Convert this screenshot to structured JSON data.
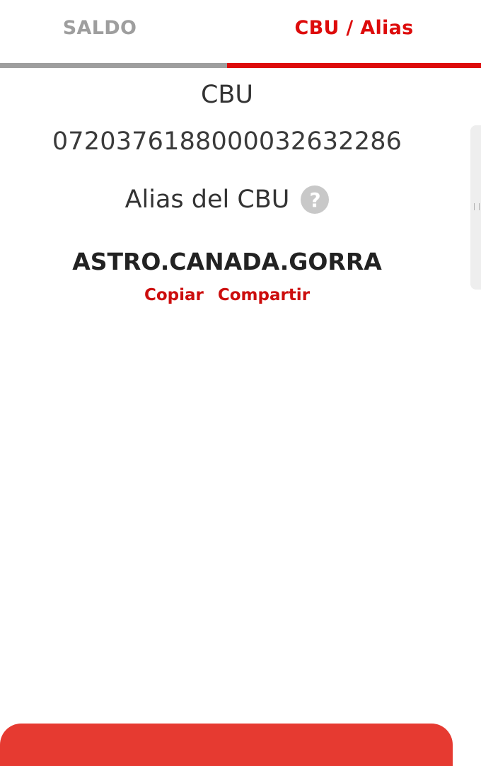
{
  "tabs": {
    "saldo_label": "SALDO",
    "cbu_alias_label": "CBU / Alias",
    "active": "cbu_alias"
  },
  "cbu": {
    "title": "CBU",
    "number": "0720376188000032632286"
  },
  "alias": {
    "label": "Alias del CBU",
    "help_icon_glyph": "?",
    "value": "ASTRO.CANADA.GORRA"
  },
  "actions": {
    "copy_label": "Copiar",
    "share_label": "Compartir"
  },
  "colors": {
    "accent": "#dd0b0b",
    "inactive_tab": "#9e9e9e",
    "bottom_button": "#e63a31"
  },
  "icons": {
    "help": "question-circle-icon"
  }
}
